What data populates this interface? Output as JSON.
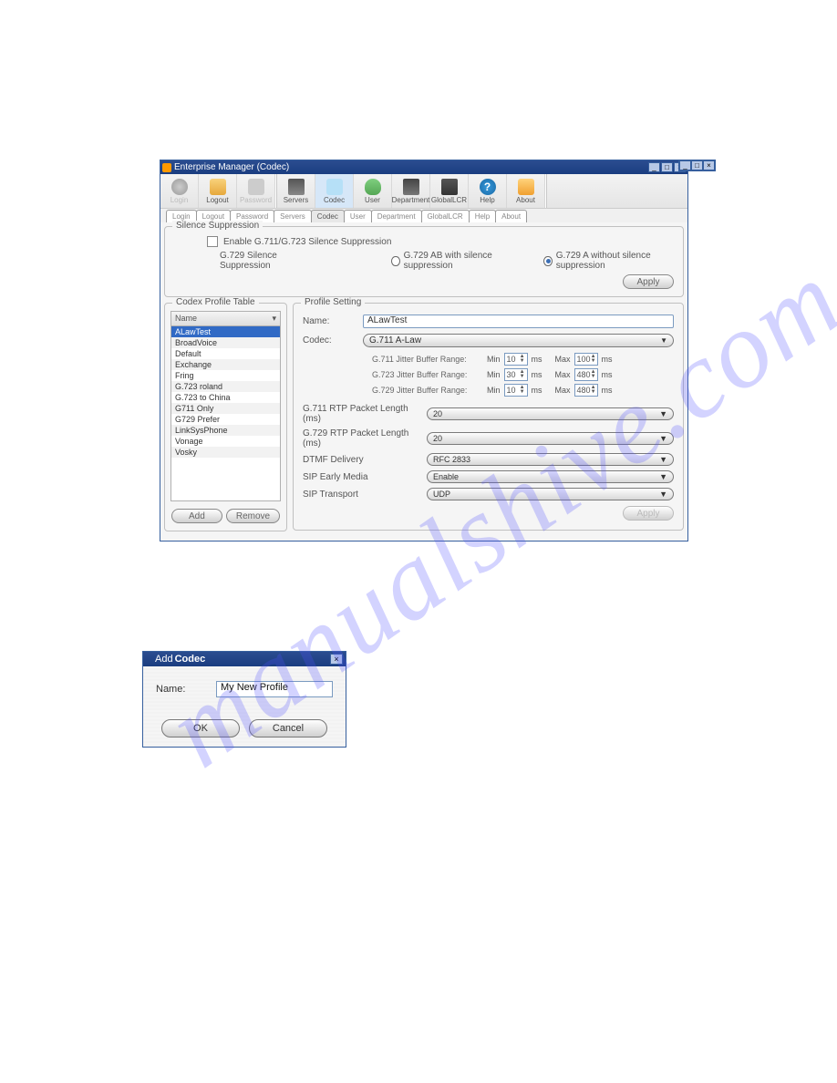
{
  "window": {
    "title": "Enterprise Manager  (Codec)",
    "toolbar": [
      {
        "label": "Login",
        "disabled": true,
        "icon": "login"
      },
      {
        "label": "Logout",
        "icon": "logout"
      },
      {
        "label": "Password",
        "disabled": true,
        "icon": "password"
      },
      {
        "label": "Servers",
        "icon": "servers"
      },
      {
        "label": "Codec",
        "active": true,
        "icon": "codec"
      },
      {
        "label": "User",
        "icon": "user"
      },
      {
        "label": "Department",
        "icon": "department"
      },
      {
        "label": "GlobalLCR",
        "icon": "globallcr"
      },
      {
        "label": "Help",
        "icon": "help"
      },
      {
        "label": "About",
        "icon": "about"
      }
    ],
    "tabs": [
      "Login",
      "Logout",
      "Password",
      "Servers",
      "Codec",
      "User",
      "Department",
      "GlobalLCR",
      "Help",
      "About"
    ],
    "active_tab": "Codec"
  },
  "silence": {
    "title": "Silence Suppression",
    "checkbox_label": "Enable G.711/G.723 Silence Suppression",
    "g729_label": "G.729 Silence Suppression",
    "radio1": "G.729 AB with silence suppression",
    "radio2": "G.729 A without silence suppression",
    "apply": "Apply"
  },
  "profile_table": {
    "title": "Codex Profile Table",
    "col": "Name",
    "items": [
      "ALawTest",
      "BroadVoice",
      "Default",
      "Exchange",
      "Fring",
      "G.723 roland",
      "G.723 to China",
      "G711 Only",
      "G729 Prefer",
      "LinkSysPhone",
      "Vonage",
      "Vosky"
    ],
    "selected": "ALawTest",
    "add": "Add",
    "remove": "Remove"
  },
  "profile": {
    "title": "Profile Setting",
    "name_label": "Name:",
    "name_value": "ALawTest",
    "codec_label": "Codec:",
    "codec_value": "G.711 A-Law",
    "jitter": {
      "g711": {
        "label": "G.711 Jitter Buffer Range:",
        "min": "10",
        "max": "100"
      },
      "g723": {
        "label": "G.723 Jitter Buffer Range:",
        "min": "30",
        "max": "480"
      },
      "g729": {
        "label": "G.729 Jitter Buffer Range:",
        "min": "10",
        "max": "480"
      },
      "min_label": "Min",
      "max_label": "Max",
      "ms": "ms"
    },
    "settings": [
      {
        "label": "G.711 RTP Packet Length (ms)",
        "value": "20"
      },
      {
        "label": "G.729 RTP Packet Length (ms)",
        "value": "20"
      },
      {
        "label": "DTMF Delivery",
        "value": "RFC 2833"
      },
      {
        "label": "SIP Early Media",
        "value": "Enable"
      },
      {
        "label": "SIP Transport",
        "value": "UDP"
      }
    ],
    "apply": "Apply"
  },
  "dialog": {
    "title_prefix": "Add ",
    "title_bold": "Codec",
    "name_label": "Name:",
    "name_value": "My New Profile",
    "ok": "OK",
    "cancel": "Cancel"
  }
}
